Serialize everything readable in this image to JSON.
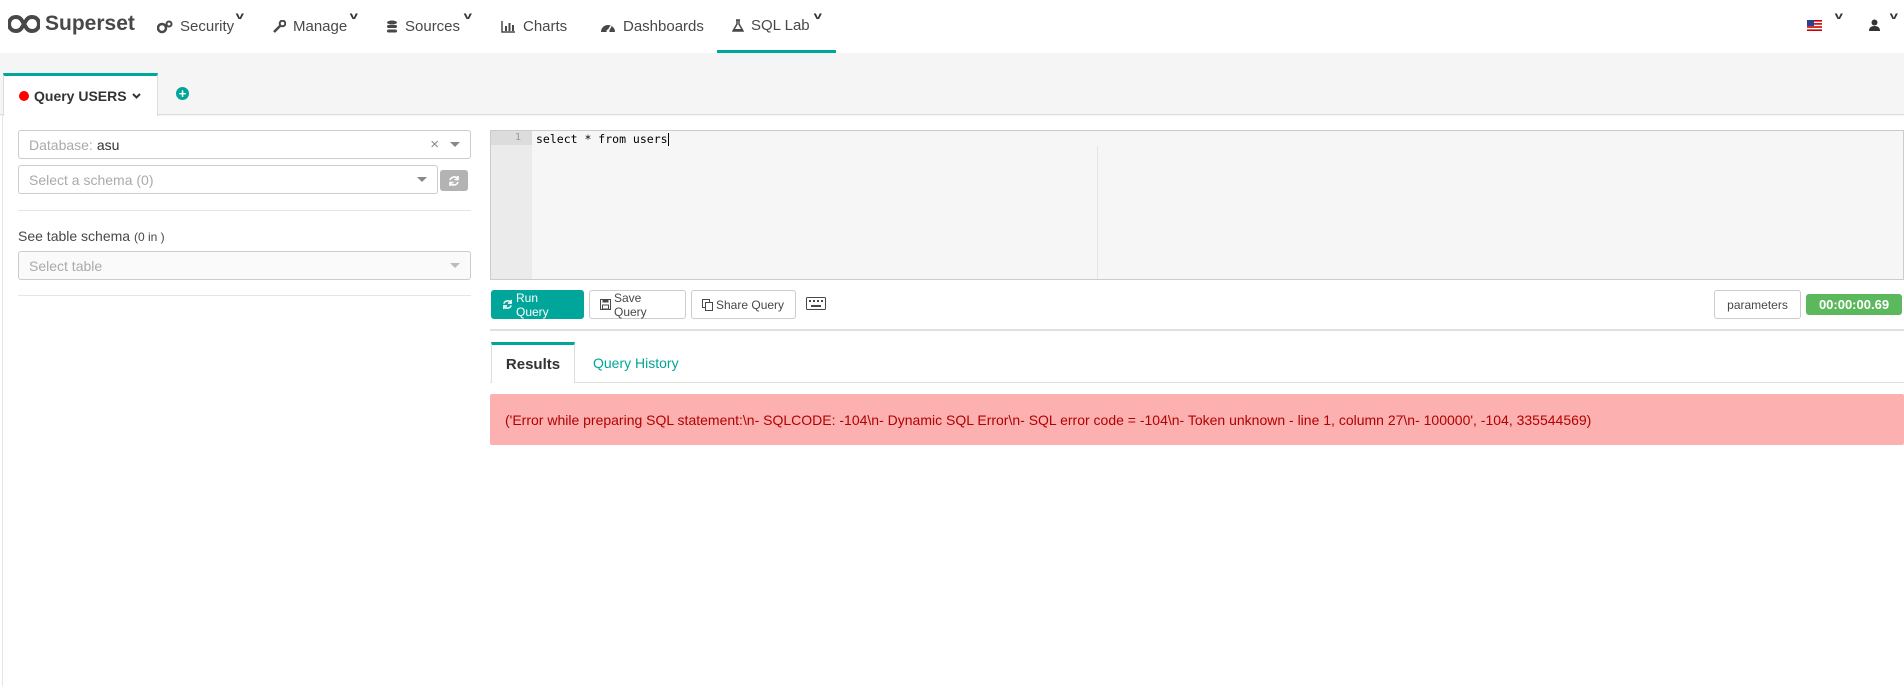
{
  "navbar": {
    "brand": "Superset",
    "items": [
      {
        "label": "Security"
      },
      {
        "label": "Manage"
      },
      {
        "label": "Sources"
      },
      {
        "label": "Charts"
      },
      {
        "label": "Dashboards"
      },
      {
        "label": "SQL Lab"
      }
    ],
    "active_item": "SQL Lab"
  },
  "query_tab": {
    "label": "Query USERS"
  },
  "left_pane": {
    "database": {
      "prefix": "Database:",
      "value": "asu"
    },
    "schema": {
      "placeholder": "Select a schema (0)"
    },
    "table_schema_label": "See table schema",
    "table_schema_count": "(0 in )",
    "table": {
      "placeholder": "Select table"
    }
  },
  "editor": {
    "line_number": "1",
    "sql": "select * from users"
  },
  "toolbar": {
    "run_label": "Run Query",
    "save_label": "Save Query",
    "share_label": "Share Query",
    "parameters_label": "parameters",
    "timer": "00:00:00.69"
  },
  "results": {
    "tabs": [
      {
        "label": "Results"
      },
      {
        "label": "Query History"
      }
    ],
    "error": "('Error while preparing SQL statement:\\n- SQLCODE: -104\\n- Dynamic SQL Error\\n- SQL error code = -104\\n- Token unknown - line 1, column 27\\n- 100000', -104, 335544569)"
  },
  "colors": {
    "accent": "#00a699",
    "error_bg": "#fcb0b0",
    "error_text": "#b30000",
    "timer": "#5cb85c",
    "status_dot": "#ff0000"
  },
  "icons": [
    "superset-logo-icon",
    "gears-icon",
    "wrench-icon",
    "database-icon",
    "bar-chart-icon",
    "dashboard-icon",
    "flask-icon",
    "us-flag-icon",
    "user-icon",
    "add-tab-icon",
    "refresh-icon",
    "save-icon",
    "copy-icon",
    "keyboard-icon"
  ]
}
